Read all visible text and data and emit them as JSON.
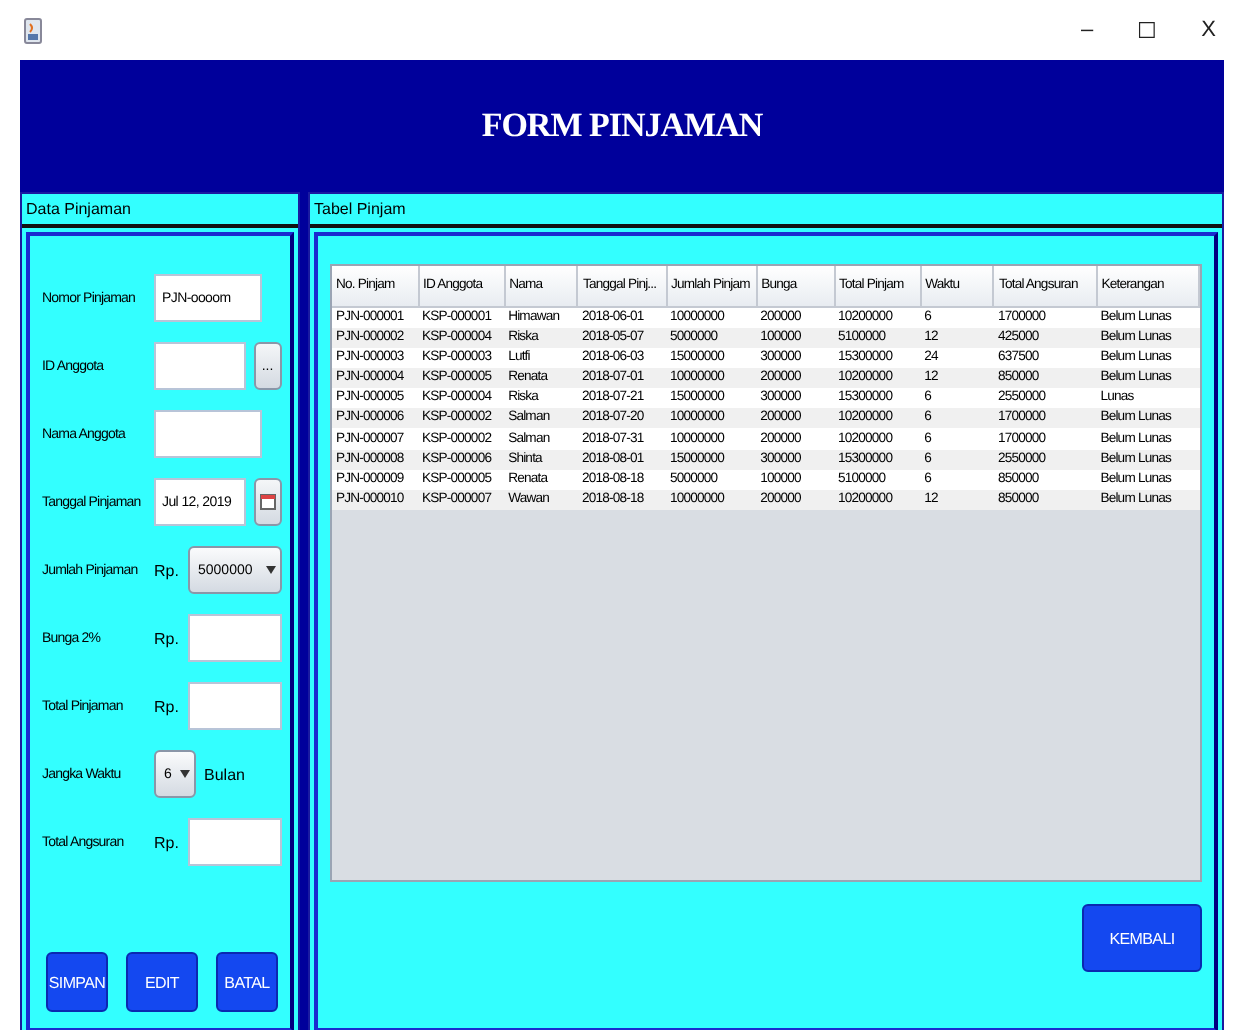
{
  "window": {
    "controls": [
      "–",
      "☐",
      "X"
    ]
  },
  "header": {
    "title": "FORM PINJAMAN"
  },
  "form_panel": {
    "title": "Data Pinjaman",
    "fields": [
      {
        "kind": "text",
        "label": "Nomor Pinjaman",
        "value": "PJN-oooom"
      },
      {
        "kind": "text-button",
        "label": "ID Anggota",
        "button": "..."
      },
      {
        "kind": "text",
        "label": "Nama Anggota"
      },
      {
        "kind": "date",
        "label": "Tanggal Pinjaman",
        "value": "Jul 12, 2019"
      },
      {
        "kind": "rp-combo",
        "label": "Jumlah Pinjaman",
        "prefix": "Rp.",
        "value": "5000000"
      },
      {
        "kind": "rp-text",
        "label": "Bunga 2%",
        "prefix": "Rp."
      },
      {
        "kind": "rp-text",
        "label": "Total Pinjaman",
        "prefix": "Rp."
      },
      {
        "kind": "combo-suffix",
        "label": "Jangka Waktu",
        "value": "6",
        "suffix": "Bulan"
      },
      {
        "kind": "rp-text",
        "label": "Total Angsuran",
        "prefix": "Rp."
      }
    ],
    "buttons": [
      "SIMPAN",
      "EDIT",
      "BATAL"
    ]
  },
  "table_panel": {
    "title": "Tabel Pinjam",
    "columns": [
      "No. Pinjam",
      "ID Anggota",
      "Nama",
      "Tanggal Pinj...",
      "Jumlah Pinjam",
      "Bunga",
      "Total Pinjam",
      "Waktu",
      "Total Angsuran",
      "Keterangan"
    ],
    "rows": [
      [
        "PJN-000001",
        "KSP-000001",
        "Himawan",
        "2018-06-01",
        "10000000",
        "200000",
        "10200000",
        "6",
        "1700000",
        "Belum Lunas"
      ],
      [
        "PJN-000002",
        "KSP-000004",
        "Riska",
        "2018-05-07",
        "5000000",
        "100000",
        "5100000",
        "12",
        "425000",
        "Belum Lunas"
      ],
      [
        "PJN-000003",
        "KSP-000003",
        "Lutfi",
        "2018-06-03",
        "15000000",
        "300000",
        "15300000",
        "24",
        "637500",
        "Belum Lunas"
      ],
      [
        "PJN-000004",
        "KSP-000005",
        "Renata",
        "2018-07-01",
        "10000000",
        "200000",
        "10200000",
        "12",
        "850000",
        "Belum Lunas"
      ],
      [
        "PJN-000005",
        "KSP-000004",
        "Riska",
        "2018-07-21",
        "15000000",
        "300000",
        "15300000",
        "6",
        "2550000",
        "Lunas"
      ],
      [
        "PJN-000006",
        "KSP-000002",
        "Salman",
        "2018-07-20",
        "10000000",
        "200000",
        "10200000",
        "6",
        "1700000",
        "Belum Lunas"
      ],
      [
        "PJN-000007",
        "KSP-000002",
        "Salman",
        "2018-07-31",
        "10000000",
        "200000",
        "10200000",
        "6",
        "1700000",
        "Belum Lunas"
      ],
      [
        "PJN-000008",
        "KSP-000006",
        "Shinta",
        "2018-08-01",
        "15000000",
        "300000",
        "15300000",
        "6",
        "2550000",
        "Belum Lunas"
      ],
      [
        "PJN-000009",
        "KSP-000005",
        "Renata",
        "2018-08-18",
        "5000000",
        "100000",
        "5100000",
        "6",
        "850000",
        "Belum Lunas"
      ],
      [
        "PJN-000010",
        "KSP-000007",
        "Wawan",
        "2018-08-18",
        "10000000",
        "200000",
        "10200000",
        "12",
        "850000",
        "Belum Lunas"
      ]
    ],
    "button": "KEMBALI"
  }
}
